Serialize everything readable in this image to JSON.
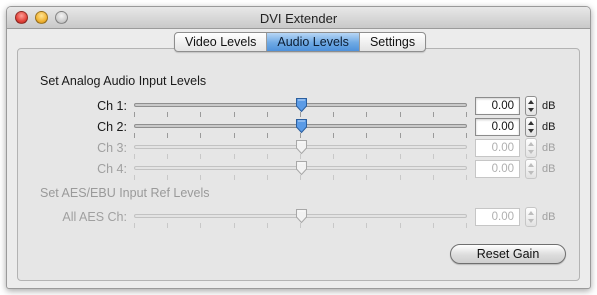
{
  "window": {
    "title": "DVI Extender"
  },
  "tabs": [
    {
      "label": "Video Levels",
      "active": false
    },
    {
      "label": "Audio Levels",
      "active": true
    },
    {
      "label": "Settings",
      "active": false
    }
  ],
  "analog": {
    "title": "Set Analog Audio Input Levels",
    "channels": [
      {
        "label": "Ch 1:",
        "value": "0.00",
        "unit": "dB",
        "enabled": true,
        "level": 0.5
      },
      {
        "label": "Ch 2:",
        "value": "0.00",
        "unit": "dB",
        "enabled": true,
        "level": 0.5
      },
      {
        "label": "Ch 3:",
        "value": "0.00",
        "unit": "dB",
        "enabled": false,
        "level": 0.5
      },
      {
        "label": "Ch 4:",
        "value": "0.00",
        "unit": "dB",
        "enabled": false,
        "level": 0.5
      }
    ]
  },
  "aes": {
    "title": "Set AES/EBU Input Ref Levels",
    "channel": {
      "label": "All AES Ch:",
      "value": "0.00",
      "unit": "dB",
      "enabled": false,
      "level": 0.5
    }
  },
  "buttons": {
    "reset_gain": "Reset Gain"
  },
  "colors": {
    "accent": "#4f92dc",
    "knob_active": "#5b9be6",
    "disabled_text": "#a0a0a0"
  }
}
